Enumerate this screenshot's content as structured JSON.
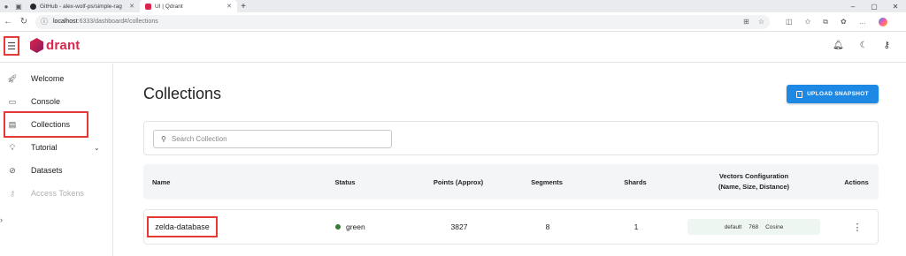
{
  "browser": {
    "tabs": [
      {
        "title": "GitHub - alex-wolf-ps/simple-rag"
      },
      {
        "title": "UI | Qdrant"
      }
    ],
    "address": {
      "host": "localhost",
      "path": ":6333/dashboard#/collections"
    },
    "window_controls": [
      "–",
      "▢",
      "✕"
    ]
  },
  "header": {
    "brand": "drant",
    "icons": [
      "bell-icon",
      "moon-icon",
      "key-icon"
    ]
  },
  "sidebar": {
    "items": [
      {
        "label": "Welcome",
        "icon": "rocket-icon"
      },
      {
        "label": "Console",
        "icon": "terminal-icon"
      },
      {
        "label": "Collections",
        "icon": "collections-icon"
      },
      {
        "label": "Tutorial",
        "icon": "lightbulb-icon"
      },
      {
        "label": "Datasets",
        "icon": "dataset-icon"
      },
      {
        "label": "Access Tokens",
        "icon": "key-icon"
      }
    ]
  },
  "main": {
    "title": "Collections",
    "upload_label": "UPLOAD SNAPSHOT",
    "search_placeholder": "Search Collection",
    "columns": {
      "name": "Name",
      "status": "Status",
      "points": "Points (Approx)",
      "segments": "Segments",
      "shards": "Shards",
      "vectors_line1": "Vectors Configuration",
      "vectors_line2": "(Name, Size, Distance)",
      "actions": "Actions"
    },
    "rows": [
      {
        "name": "zelda-database",
        "status": "green",
        "points": "3827",
        "segments": "8",
        "shards": "1",
        "vector_name": "default",
        "vector_size": "768",
        "vector_distance": "Cosine"
      }
    ]
  },
  "colors": {
    "accent": "#1e88e5",
    "brand": "#dc244c",
    "status_green": "#2e7d32",
    "highlight": "#e53935"
  }
}
